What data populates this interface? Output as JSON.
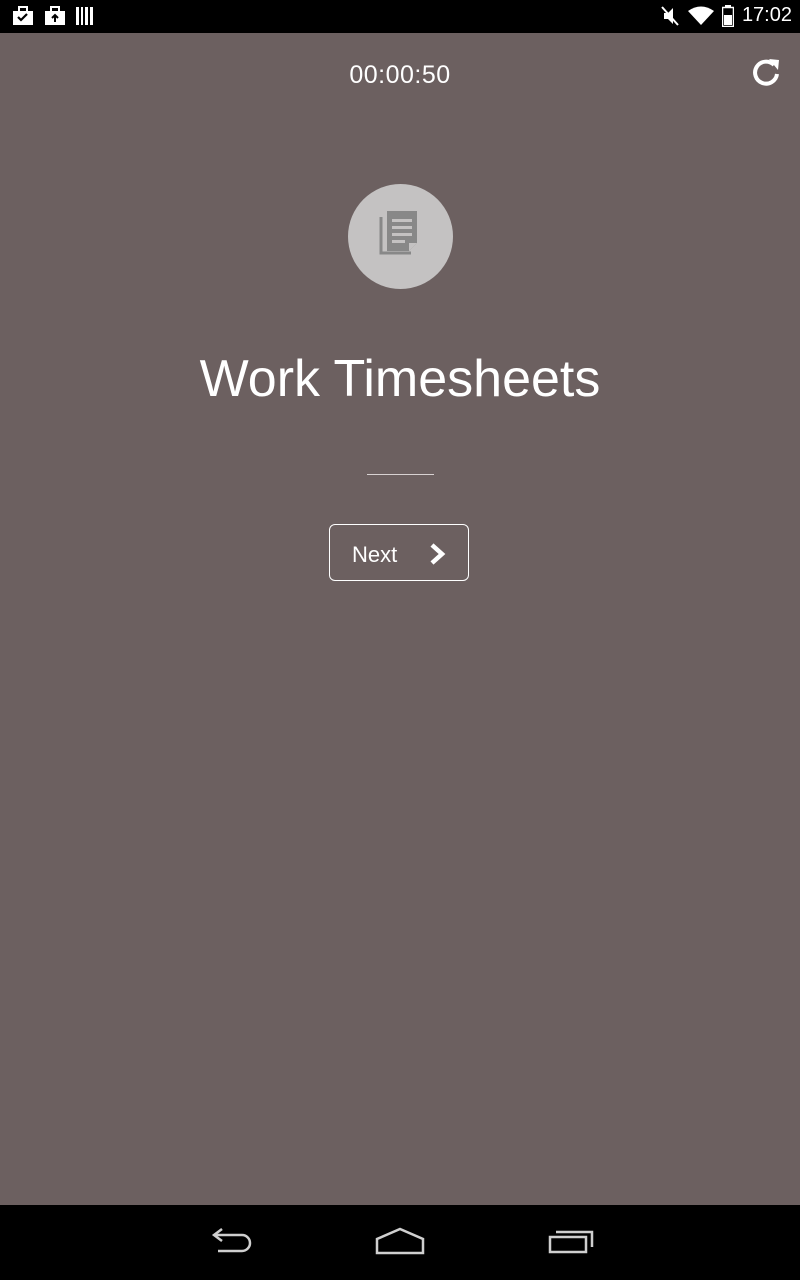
{
  "status_bar": {
    "time": "17:02",
    "left_icons": [
      "briefcase-check-icon",
      "briefcase-upload-icon",
      "barcode-icon"
    ],
    "right_icons": [
      "mute-icon",
      "wifi-icon",
      "battery-icon"
    ]
  },
  "screen": {
    "timer": "00:00:50",
    "title": "Work Timesheets",
    "next_label": "Next",
    "icon": "documents-icon",
    "refresh_icon": "refresh-icon"
  },
  "nav_bar": {
    "buttons": [
      "back-icon",
      "home-icon",
      "recents-icon"
    ]
  },
  "colors": {
    "background": "#6c6060",
    "icon_circle": "#c4c2c2",
    "text": "#ffffff",
    "bars": "#000000"
  }
}
